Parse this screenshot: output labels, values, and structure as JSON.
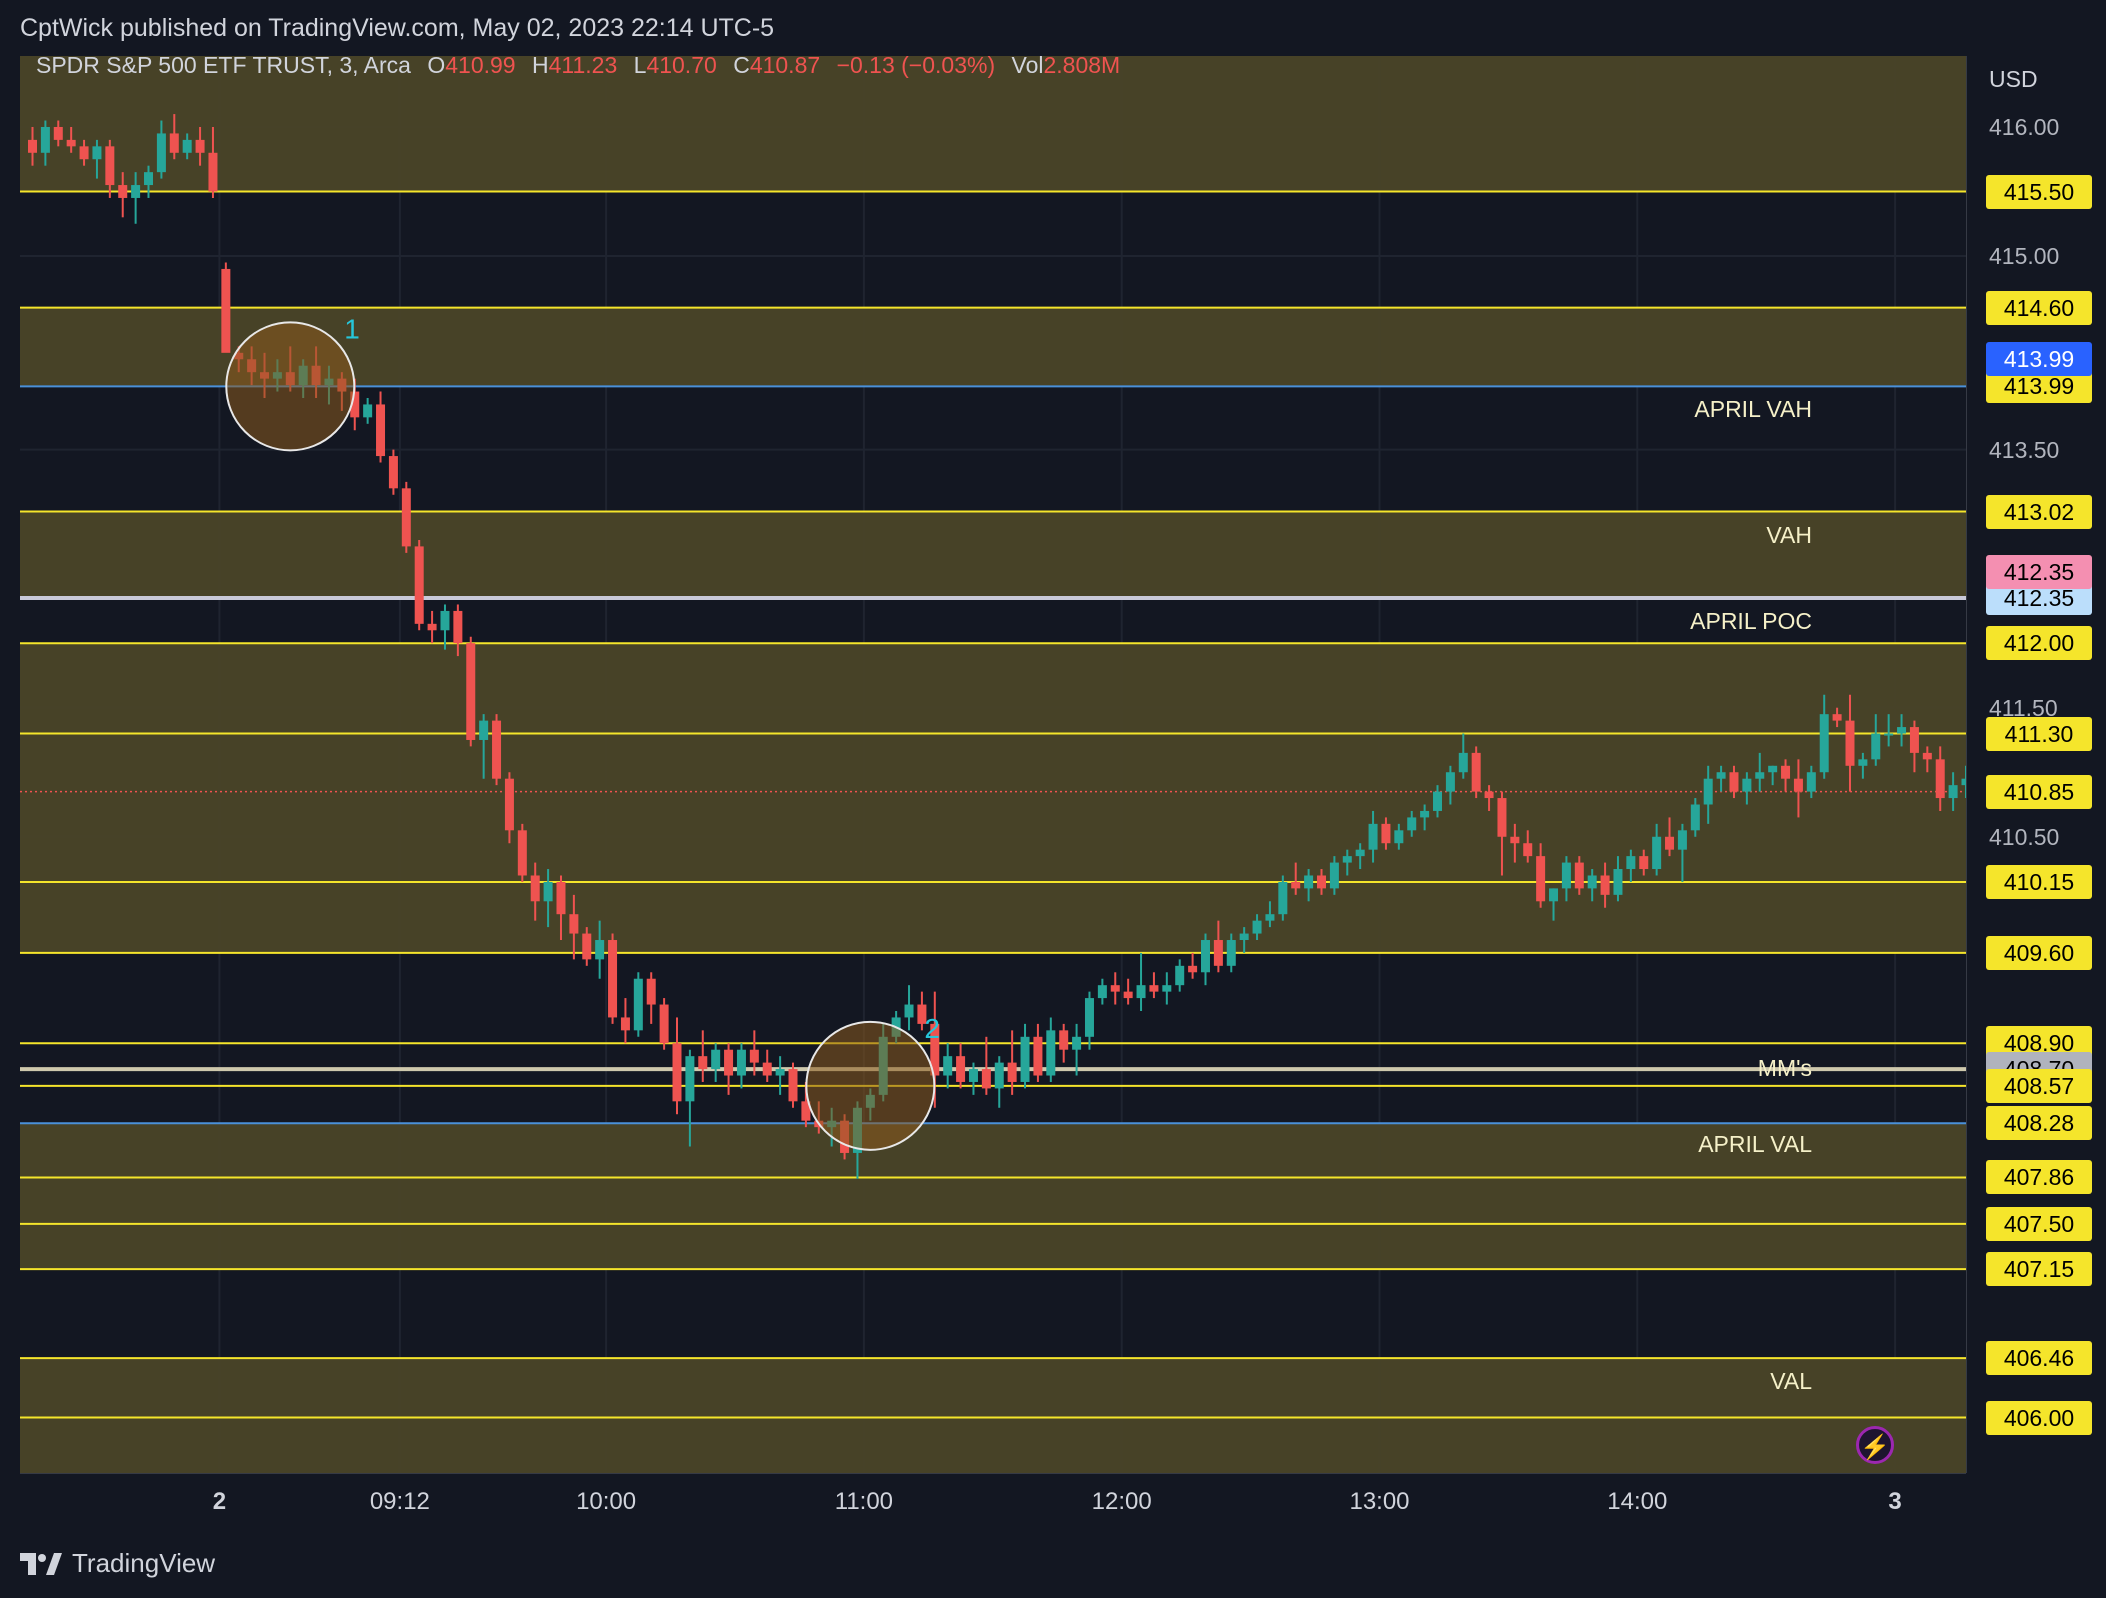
{
  "header": {
    "text": "CptWick published on TradingView.com, May 02, 2023 22:14 UTC-5"
  },
  "legend": {
    "symbol": "SPDR S&P 500 ETF TRUST, 3, Arca",
    "o_label": "O",
    "o_value": "410.99",
    "h_label": "H",
    "h_value": "411.23",
    "l_label": "L",
    "l_value": "410.70",
    "c_label": "C",
    "c_value": "410.87",
    "change": "−0.13 (−0.03%)",
    "vol_label": "Vol",
    "vol_value": "2.808M"
  },
  "footer": {
    "brand": "TradingView"
  },
  "colors": {
    "background": "#131722",
    "up": "#26a69a",
    "down": "#ef5350",
    "level_line": "#f5e52b",
    "zone_fill": "#4a4528",
    "april_line": "#4a90d9",
    "poc_line": "#c9c9d9",
    "mms_line": "#cfc9ad",
    "circle_fill": "#8a5a1e"
  },
  "flash_icon": "lightning-icon",
  "chart_data": {
    "type": "candlestick",
    "currency_label": "USD",
    "ylim": [
      405.57,
      416.55
    ],
    "y_ticks": [
      {
        "value": 416.0,
        "label": "416.00"
      },
      {
        "value": 415.0,
        "label": "415.00"
      },
      {
        "value": 413.5,
        "label": "413.50"
      },
      {
        "value": 411.5,
        "label": "411.50"
      },
      {
        "value": 410.5,
        "label": "410.50"
      }
    ],
    "x_ticks": [
      {
        "label": "2",
        "bar": 14.5,
        "bold": true
      },
      {
        "label": "09:12",
        "bar": 28.5,
        "bold": false
      },
      {
        "label": "10:00",
        "bar": 44.5,
        "bold": false
      },
      {
        "label": "11:00",
        "bar": 64.5,
        "bold": false
      },
      {
        "label": "12:00",
        "bar": 84.5,
        "bold": false
      },
      {
        "label": "13:00",
        "bar": 104.5,
        "bold": false
      },
      {
        "label": "14:00",
        "bar": 124.5,
        "bold": false
      },
      {
        "label": "3",
        "bar": 144.5,
        "bold": true
      }
    ],
    "zones": [
      {
        "from": 415.5,
        "to": 416.55
      },
      {
        "from": 413.99,
        "to": 414.6
      },
      {
        "from": 412.35,
        "to": 413.02
      },
      {
        "from": 410.15,
        "to": 412.0
      },
      {
        "from": 409.6,
        "to": 410.15
      },
      {
        "from": 407.15,
        "to": 408.28
      },
      {
        "from": 405.57,
        "to": 406.46
      }
    ],
    "levels": [
      {
        "value": 415.5,
        "label": "415.50",
        "kind": "yellow",
        "tag": "#f5e52b",
        "text": ""
      },
      {
        "value": 414.6,
        "label": "414.60",
        "kind": "yellow",
        "tag": "#f5e52b",
        "text": ""
      },
      {
        "value": 413.99,
        "label": "413.99",
        "kind": "april",
        "tag": "#f5e52b",
        "text": "APRIL VAH"
      },
      {
        "value": 413.02,
        "label": "413.02",
        "kind": "yellow",
        "tag": "#f5e52b",
        "text": "VAH"
      },
      {
        "value": 412.35,
        "label": "412.35",
        "kind": "poc",
        "tag": "#bbdefb",
        "text": "APRIL POC"
      },
      {
        "value": 412.0,
        "label": "412.00",
        "kind": "yellow",
        "tag": "#f5e52b",
        "text": ""
      },
      {
        "value": 411.3,
        "label": "411.30",
        "kind": "yellow",
        "tag": "#f5e52b",
        "text": ""
      },
      {
        "value": 410.15,
        "label": "410.15",
        "kind": "yellow",
        "tag": "#f5e52b",
        "text": ""
      },
      {
        "value": 409.6,
        "label": "409.60",
        "kind": "yellow",
        "tag": "#f5e52b",
        "text": ""
      },
      {
        "value": 408.9,
        "label": "408.90",
        "kind": "yellow",
        "tag": "#f5e52b",
        "text": ""
      },
      {
        "value": 408.7,
        "label": "408.70",
        "kind": "mms",
        "tag": "#b0b3bd",
        "text": "MM's"
      },
      {
        "value": 408.57,
        "label": "408.57",
        "kind": "yellow",
        "tag": "#f5e52b",
        "text": ""
      },
      {
        "value": 408.28,
        "label": "408.28",
        "kind": "april",
        "tag": "#f5e52b",
        "text": "APRIL VAL"
      },
      {
        "value": 407.86,
        "label": "407.86",
        "kind": "yellow",
        "tag": "#f5e52b",
        "text": ""
      },
      {
        "value": 407.5,
        "label": "407.50",
        "kind": "yellow",
        "tag": "#f5e52b",
        "text": ""
      },
      {
        "value": 407.15,
        "label": "407.15",
        "kind": "yellow",
        "tag": "#f5e52b",
        "text": ""
      },
      {
        "value": 406.46,
        "label": "406.46",
        "kind": "yellow",
        "tag": "#f5e52b",
        "text": "VAL"
      },
      {
        "value": 406.0,
        "label": "406.00",
        "kind": "yellow",
        "tag": "#f5e52b",
        "text": ""
      }
    ],
    "extra_tags": [
      {
        "value": 414.2,
        "label": "413.99",
        "color": "#2962ff",
        "text_color": "#ffffff"
      },
      {
        "value": 412.55,
        "label": "412.35",
        "color": "#f48fb1",
        "text_color": "#000000"
      }
    ],
    "current_price": {
      "value": 410.85,
      "label": "410.85"
    },
    "circles": [
      {
        "label": "1",
        "bar": 20,
        "price": 413.99
      },
      {
        "label": "2",
        "bar": 65,
        "price": 408.57
      }
    ],
    "candles_ohlc": [
      [
        415.9,
        416.0,
        415.7,
        415.8
      ],
      [
        415.8,
        416.05,
        415.7,
        416.0
      ],
      [
        416.0,
        416.05,
        415.85,
        415.9
      ],
      [
        415.9,
        416.0,
        415.8,
        415.85
      ],
      [
        415.85,
        415.9,
        415.7,
        415.75
      ],
      [
        415.75,
        415.9,
        415.6,
        415.85
      ],
      [
        415.85,
        415.9,
        415.45,
        415.55
      ],
      [
        415.55,
        415.65,
        415.3,
        415.45
      ],
      [
        415.45,
        415.65,
        415.25,
        415.55
      ],
      [
        415.55,
        415.7,
        415.45,
        415.65
      ],
      [
        415.65,
        416.05,
        415.6,
        415.95
      ],
      [
        415.95,
        416.1,
        415.75,
        415.8
      ],
      [
        415.8,
        415.95,
        415.75,
        415.9
      ],
      [
        415.9,
        416.0,
        415.7,
        415.8
      ],
      [
        415.8,
        416.0,
        415.45,
        415.5
      ],
      [
        414.9,
        414.95,
        414.3,
        414.25
      ],
      [
        414.25,
        414.3,
        414.1,
        414.2
      ],
      [
        414.2,
        414.3,
        414.0,
        414.1
      ],
      [
        414.1,
        414.25,
        413.9,
        414.05
      ],
      [
        414.05,
        414.2,
        413.95,
        414.1
      ],
      [
        414.1,
        414.3,
        413.95,
        414.0
      ],
      [
        414.0,
        414.2,
        413.9,
        414.15
      ],
      [
        414.15,
        414.3,
        413.9,
        414.0
      ],
      [
        414.0,
        414.15,
        413.85,
        414.05
      ],
      [
        414.05,
        414.1,
        413.8,
        413.95
      ],
      [
        413.95,
        414.05,
        413.65,
        413.75
      ],
      [
        413.75,
        413.9,
        413.7,
        413.85
      ],
      [
        413.85,
        413.95,
        413.4,
        413.45
      ],
      [
        413.45,
        413.5,
        413.15,
        413.2
      ],
      [
        413.2,
        413.25,
        412.7,
        412.75
      ],
      [
        412.75,
        412.8,
        412.1,
        412.15
      ],
      [
        412.15,
        412.25,
        412.0,
        412.1
      ],
      [
        412.1,
        412.3,
        411.95,
        412.25
      ],
      [
        412.25,
        412.3,
        411.9,
        412.0
      ],
      [
        412.0,
        412.05,
        411.2,
        411.25
      ],
      [
        411.25,
        411.45,
        410.95,
        411.4
      ],
      [
        411.4,
        411.45,
        410.9,
        410.95
      ],
      [
        410.95,
        411.0,
        410.45,
        410.55
      ],
      [
        410.55,
        410.6,
        410.15,
        410.2
      ],
      [
        410.2,
        410.3,
        409.85,
        410.0
      ],
      [
        410.0,
        410.25,
        409.8,
        410.15
      ],
      [
        410.15,
        410.2,
        409.7,
        409.9
      ],
      [
        409.9,
        410.05,
        409.55,
        409.75
      ],
      [
        409.75,
        409.8,
        409.5,
        409.55
      ],
      [
        409.55,
        409.85,
        409.4,
        409.7
      ],
      [
        409.7,
        409.75,
        409.05,
        409.1
      ],
      [
        409.1,
        409.25,
        408.9,
        409.0
      ],
      [
        409.0,
        409.45,
        408.95,
        409.4
      ],
      [
        409.4,
        409.45,
        409.05,
        409.2
      ],
      [
        409.2,
        409.25,
        408.85,
        408.9
      ],
      [
        408.9,
        409.1,
        408.35,
        408.45
      ],
      [
        408.45,
        408.85,
        408.1,
        408.8
      ],
      [
        408.8,
        409.0,
        408.6,
        408.7
      ],
      [
        408.7,
        408.9,
        408.6,
        408.85
      ],
      [
        408.85,
        408.9,
        408.5,
        408.65
      ],
      [
        408.65,
        408.9,
        408.55,
        408.85
      ],
      [
        408.85,
        409.0,
        408.65,
        408.75
      ],
      [
        408.75,
        408.85,
        408.6,
        408.65
      ],
      [
        408.65,
        408.8,
        408.5,
        408.7
      ],
      [
        408.7,
        408.75,
        408.4,
        408.45
      ],
      [
        408.45,
        408.6,
        408.25,
        408.3
      ],
      [
        408.3,
        408.45,
        408.2,
        408.25
      ],
      [
        408.25,
        408.4,
        408.1,
        408.3
      ],
      [
        408.3,
        408.35,
        408.0,
        408.05
      ],
      [
        408.05,
        408.45,
        407.85,
        408.4
      ],
      [
        408.4,
        408.55,
        408.3,
        408.5
      ],
      [
        408.5,
        409.05,
        408.45,
        408.95
      ],
      [
        408.95,
        409.15,
        408.9,
        409.1
      ],
      [
        409.1,
        409.35,
        409.0,
        409.2
      ],
      [
        409.2,
        409.3,
        409.0,
        409.05
      ],
      [
        409.05,
        409.3,
        408.4,
        408.65
      ],
      [
        408.65,
        408.9,
        408.55,
        408.8
      ],
      [
        408.8,
        408.9,
        408.55,
        408.6
      ],
      [
        408.6,
        408.75,
        408.5,
        408.7
      ],
      [
        408.7,
        408.95,
        408.5,
        408.55
      ],
      [
        408.55,
        408.8,
        408.4,
        408.75
      ],
      [
        408.75,
        409.0,
        408.5,
        408.6
      ],
      [
        408.6,
        409.05,
        408.55,
        408.95
      ],
      [
        408.95,
        409.05,
        408.6,
        408.65
      ],
      [
        408.65,
        409.1,
        408.6,
        409.0
      ],
      [
        409.0,
        409.05,
        408.75,
        408.85
      ],
      [
        408.85,
        409.05,
        408.65,
        408.95
      ],
      [
        408.95,
        409.3,
        408.85,
        409.25
      ],
      [
        409.25,
        409.4,
        409.2,
        409.35
      ],
      [
        409.35,
        409.45,
        409.2,
        409.3
      ],
      [
        409.3,
        409.4,
        409.2,
        409.25
      ],
      [
        409.25,
        409.6,
        409.15,
        409.35
      ],
      [
        409.35,
        409.45,
        409.25,
        409.3
      ],
      [
        409.3,
        409.45,
        409.2,
        409.35
      ],
      [
        409.35,
        409.55,
        409.3,
        409.5
      ],
      [
        409.5,
        409.6,
        409.4,
        409.45
      ],
      [
        409.45,
        409.75,
        409.35,
        409.7
      ],
      [
        409.7,
        409.85,
        409.45,
        409.5
      ],
      [
        409.5,
        409.75,
        409.45,
        409.7
      ],
      [
        409.7,
        409.8,
        409.6,
        409.75
      ],
      [
        409.75,
        409.9,
        409.7,
        409.85
      ],
      [
        409.85,
        410.0,
        409.8,
        409.9
      ],
      [
        409.9,
        410.2,
        409.85,
        410.15
      ],
      [
        410.15,
        410.3,
        410.05,
        410.1
      ],
      [
        410.1,
        410.25,
        410.0,
        410.2
      ],
      [
        410.2,
        410.25,
        410.05,
        410.1
      ],
      [
        410.1,
        410.35,
        410.05,
        410.3
      ],
      [
        410.3,
        410.4,
        410.2,
        410.35
      ],
      [
        410.35,
        410.45,
        410.25,
        410.4
      ],
      [
        410.4,
        410.7,
        410.3,
        410.6
      ],
      [
        410.6,
        410.65,
        410.4,
        410.45
      ],
      [
        410.45,
        410.6,
        410.4,
        410.55
      ],
      [
        410.55,
        410.7,
        410.5,
        410.65
      ],
      [
        410.65,
        410.75,
        410.55,
        410.7
      ],
      [
        410.7,
        410.9,
        410.65,
        410.85
      ],
      [
        410.85,
        411.05,
        410.75,
        411.0
      ],
      [
        411.0,
        411.3,
        410.95,
        411.15
      ],
      [
        411.15,
        411.2,
        410.8,
        410.85
      ],
      [
        410.85,
        410.9,
        410.7,
        410.8
      ],
      [
        410.8,
        410.85,
        410.2,
        410.5
      ],
      [
        410.5,
        410.6,
        410.3,
        410.45
      ],
      [
        410.45,
        410.55,
        410.3,
        410.35
      ],
      [
        410.35,
        410.45,
        409.95,
        410.0
      ],
      [
        410.0,
        410.1,
        409.85,
        410.1
      ],
      [
        410.1,
        410.35,
        410.0,
        410.3
      ],
      [
        410.3,
        410.35,
        410.05,
        410.1
      ],
      [
        410.1,
        410.25,
        410.0,
        410.2
      ],
      [
        410.2,
        410.3,
        409.95,
        410.05
      ],
      [
        410.05,
        410.35,
        410.0,
        410.25
      ],
      [
        410.25,
        410.4,
        410.15,
        410.35
      ],
      [
        410.35,
        410.4,
        410.2,
        410.25
      ],
      [
        410.25,
        410.6,
        410.2,
        410.5
      ],
      [
        410.5,
        410.65,
        410.35,
        410.4
      ],
      [
        410.4,
        410.6,
        410.15,
        410.55
      ],
      [
        410.55,
        410.8,
        410.5,
        410.75
      ],
      [
        410.75,
        411.05,
        410.6,
        410.95
      ],
      [
        410.95,
        411.05,
        410.85,
        411.0
      ],
      [
        411.0,
        411.05,
        410.8,
        410.85
      ],
      [
        410.85,
        411.0,
        410.75,
        410.95
      ],
      [
        410.95,
        411.15,
        410.85,
        411.0
      ],
      [
        411.0,
        411.05,
        410.9,
        411.05
      ],
      [
        411.05,
        411.1,
        410.85,
        410.95
      ],
      [
        410.95,
        411.1,
        410.65,
        410.85
      ],
      [
        410.85,
        411.05,
        410.8,
        411.0
      ],
      [
        411.0,
        411.6,
        410.95,
        411.45
      ],
      [
        411.45,
        411.5,
        411.35,
        411.4
      ],
      [
        411.4,
        411.6,
        410.85,
        411.05
      ],
      [
        411.05,
        411.15,
        410.95,
        411.1
      ],
      [
        411.1,
        411.45,
        411.05,
        411.3
      ],
      [
        411.3,
        411.45,
        411.2,
        411.3
      ],
      [
        411.3,
        411.45,
        411.2,
        411.35
      ],
      [
        411.35,
        411.4,
        411.0,
        411.15
      ],
      [
        411.15,
        411.2,
        411.0,
        411.1
      ],
      [
        411.1,
        411.2,
        410.7,
        410.8
      ],
      [
        410.8,
        411.0,
        410.7,
        410.9
      ],
      [
        410.9,
        411.05,
        410.8,
        410.95
      ],
      [
        410.95,
        411.0,
        410.75,
        410.85
      ],
      [
        410.85,
        411.05,
        410.7,
        411.0
      ],
      [
        411.0,
        411.05,
        410.55,
        410.6
      ],
      [
        410.6,
        410.75,
        410.45,
        410.7
      ],
      [
        410.7,
        411.35,
        410.65,
        411.2
      ],
      [
        411.2,
        411.3,
        410.95,
        411.05
      ],
      [
        411.05,
        411.2,
        410.7,
        410.9
      ]
    ]
  }
}
